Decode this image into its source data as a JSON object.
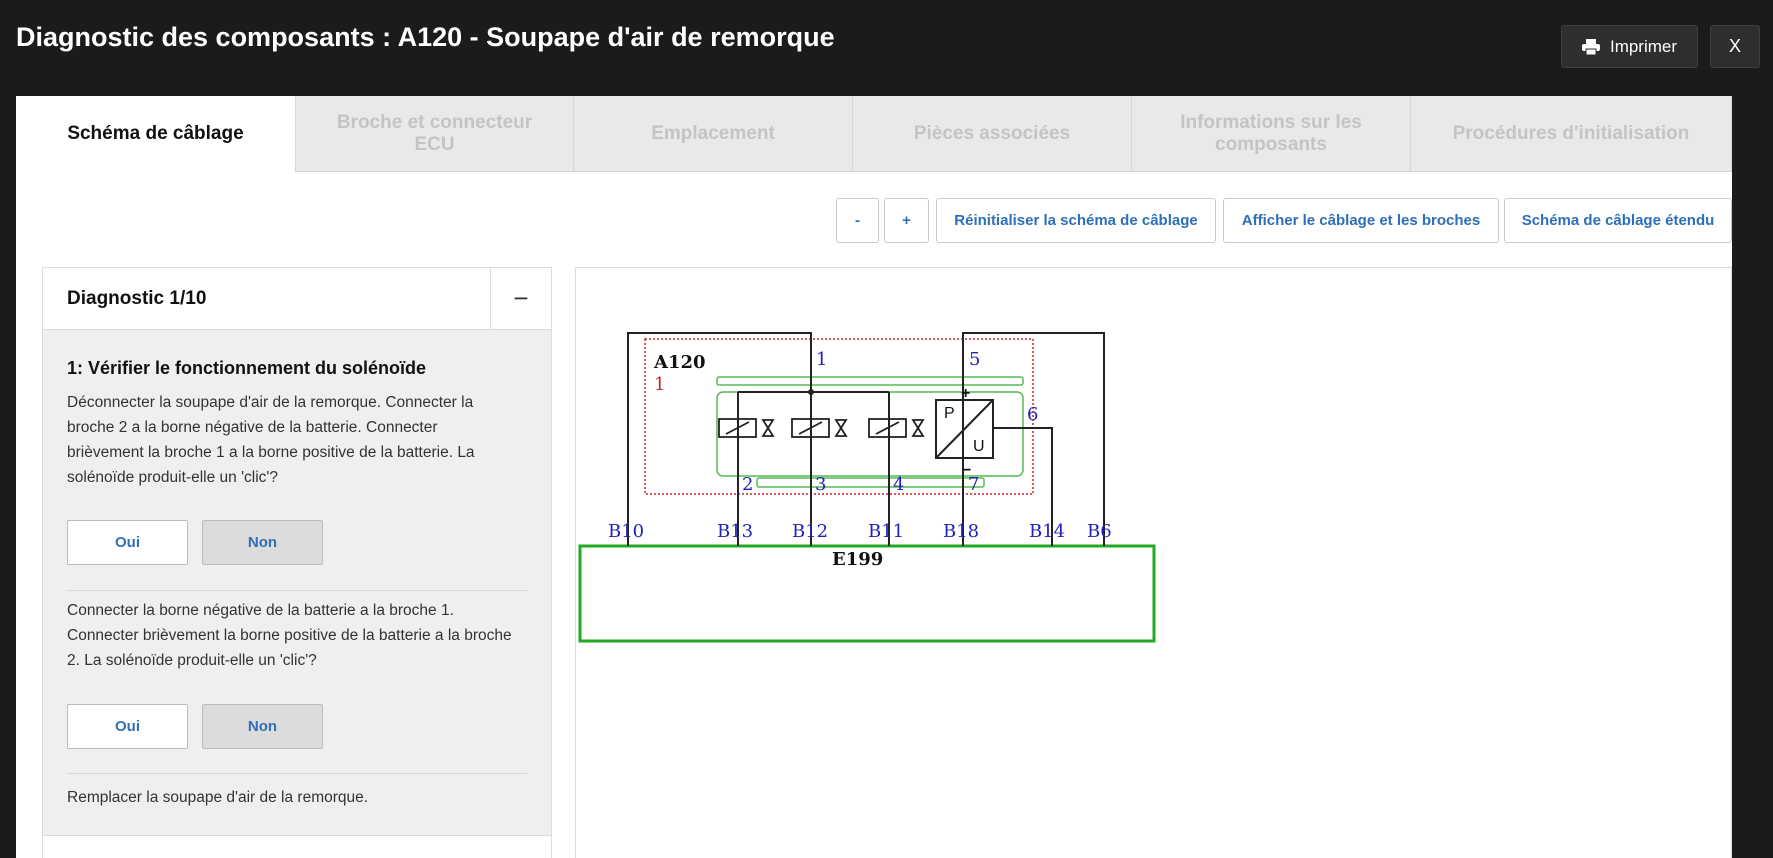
{
  "header": {
    "title": "Diagnostic des composants : A120 - Soupape d'air de remorque",
    "print_label": "Imprimer",
    "close_label": "X"
  },
  "tabs": [
    {
      "label": "Schéma de câblage",
      "active": true
    },
    {
      "label": "Broche et connecteur ECU",
      "active": false
    },
    {
      "label": "Emplacement",
      "active": false
    },
    {
      "label": "Pièces associées",
      "active": false
    },
    {
      "label": "Informations sur les composants",
      "active": false
    },
    {
      "label": "Procédures d'initialisation",
      "active": false
    }
  ],
  "toolbar": {
    "zoom_out": "-",
    "zoom_in": "+",
    "reset": "Réinitialiser la schéma de câblage",
    "show_wiring": "Afficher le câblage et les broches",
    "extended": "Schéma de câblage étendu"
  },
  "diagnostic": {
    "title": "Diagnostic 1/10",
    "collapse_symbol": "−",
    "step_title": "1: Vérifier le fonctionnement du solénoïde",
    "step1_text": "Déconnecter la soupape d'air de la remorque. Connecter la broche 2 a la borne négative de la batterie. Connecter brièvement la broche 1 a la borne positive de la batterie. La solénoïde produit-elle un 'clic'?",
    "step2_text": "Connecter la borne négative de la batterie a la broche 1. Connecter brièvement la borne positive de la batterie a la broche 2. La solénoïde produit-elle un 'clic'?",
    "step3_text": "Remplacer la soupape d'air de la remorque.",
    "yes": "Oui",
    "no": "Non"
  },
  "diagram": {
    "component": "A120",
    "component_index": "1",
    "connector": "E199",
    "pins": [
      "1",
      "5",
      "6",
      "2",
      "3",
      "4",
      "7"
    ],
    "connector_pins": [
      "B10",
      "B13",
      "B12",
      "B11",
      "B18",
      "B14",
      "B6"
    ],
    "sensor_p": "P",
    "sensor_u": "U",
    "sensor_plus": "+",
    "sensor_minus": "−",
    "colors": {
      "component_box": "#cc2222",
      "internal": "#55bb55",
      "connector": "#22aa22",
      "pin_label": "#2222bb"
    }
  }
}
